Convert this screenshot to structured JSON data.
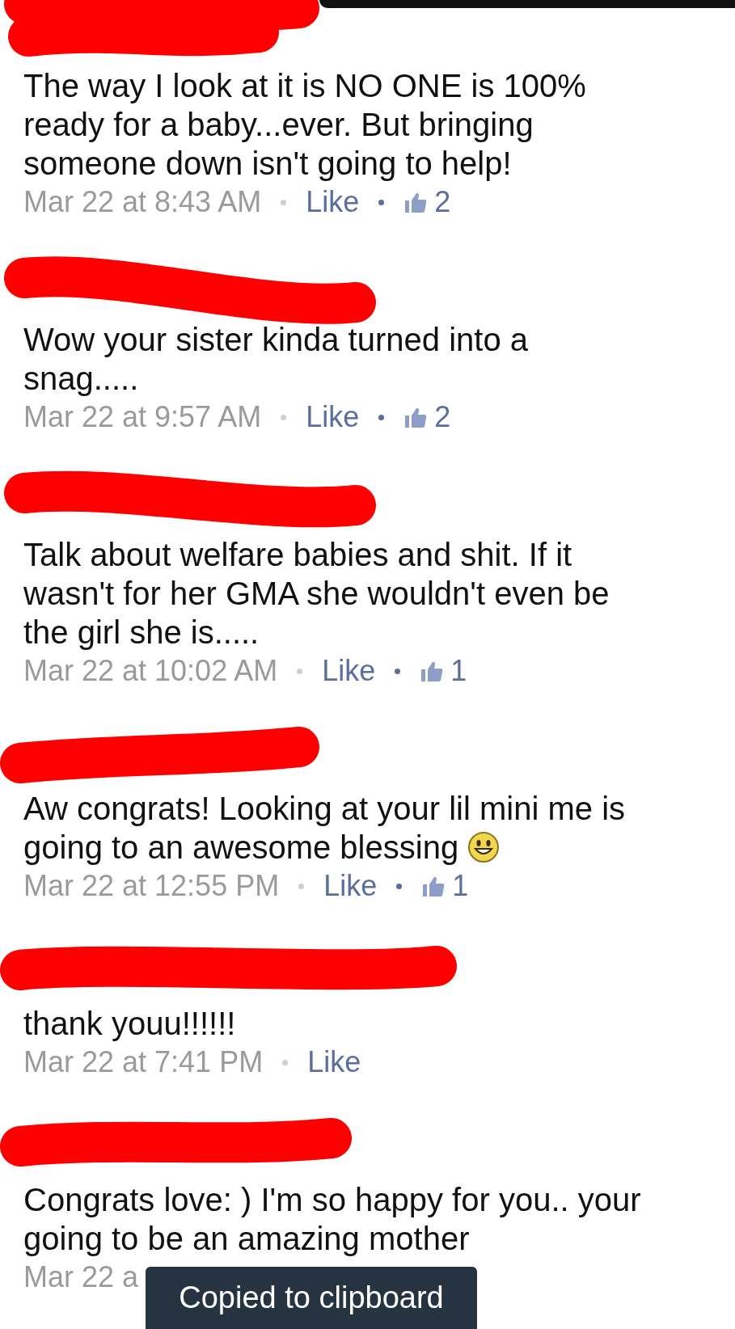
{
  "comments": [
    {
      "lines": [
        "The way I look at it is NO ONE is 100%",
        "ready for a baby...ever. But bringing",
        "someone down isn't going to help!"
      ],
      "time": "Mar 22 at 8:43 AM",
      "like": "Like",
      "likes": "2"
    },
    {
      "lines": [
        "Wow your sister kinda turned into a",
        "snag....."
      ],
      "time": "Mar 22 at 9:57 AM",
      "like": "Like",
      "likes": "2"
    },
    {
      "lines": [
        "Talk about welfare babies and shit. If it",
        "wasn't for her GMA she wouldn't even be",
        "the girl she is....."
      ],
      "time": "Mar 22 at 10:02 AM",
      "like": "Like",
      "likes": "1"
    },
    {
      "lines": [
        "Aw congrats! Looking at your lil mini me is",
        "going to an awesome blessing"
      ],
      "has_emoji": true,
      "time": "Mar 22 at 12:55 PM",
      "like": "Like",
      "likes": "1"
    },
    {
      "lines": [
        "thank youu!!!!!!"
      ],
      "time": "Mar 22 at 7:41 PM",
      "like": "Like"
    },
    {
      "lines": [
        "Congrats love: ) I'm so happy for you.. your",
        "going to be an amazing mother"
      ],
      "time": "Mar 22 a"
    }
  ],
  "toast": {
    "text": "Copied to clipboard"
  }
}
